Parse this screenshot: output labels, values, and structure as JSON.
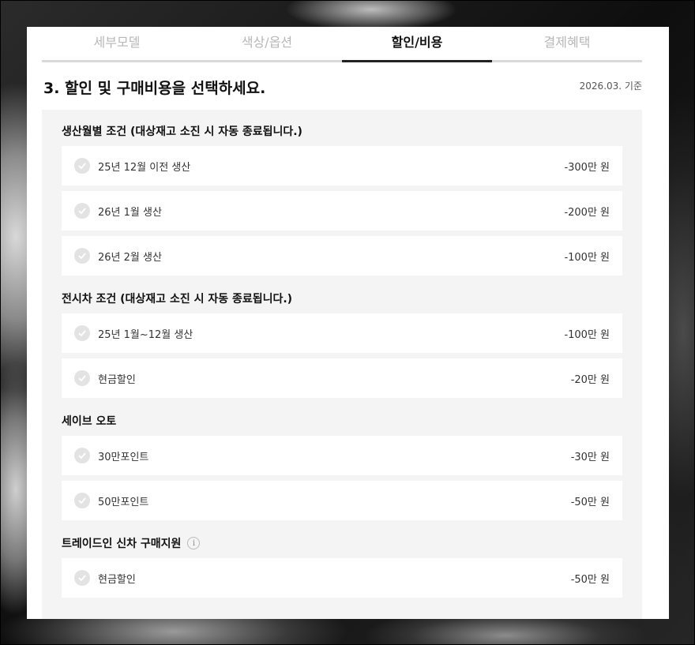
{
  "tabs": [
    "세부모델",
    "색상/옵션",
    "할인/비용",
    "결제혜택"
  ],
  "active_tab": "할인/비용",
  "title": "3. 할인 및 구매비용을 선택하세요.",
  "as_of": "2026.03. 기준",
  "sections": [
    {
      "title": "생산월별 조건 (대상재고 소진 시 자동 종료됩니다.)",
      "items": [
        {
          "label": "25년 12월 이전 생산",
          "price": "-300만 원"
        },
        {
          "label": "26년 1월 생산",
          "price": "-200만 원"
        },
        {
          "label": "26년 2월 생산",
          "price": "-100만 원"
        }
      ]
    },
    {
      "title": "전시차 조건 (대상재고 소진 시 자동 종료됩니다.)",
      "items": [
        {
          "label": "25년 1월~12월 생산",
          "price": "-100만 원"
        },
        {
          "label": "현금할인",
          "price": "-20만 원"
        }
      ]
    },
    {
      "title": "세이브 오토",
      "items": [
        {
          "label": "30만포인트",
          "price": "-30만 원"
        },
        {
          "label": "50만포인트",
          "price": "-50만 원"
        }
      ]
    },
    {
      "title": "트레이드인 신차 구매지원",
      "info_icon": "info-icon",
      "items": [
        {
          "label": "현금할인",
          "price": "-50만 원"
        }
      ]
    }
  ]
}
